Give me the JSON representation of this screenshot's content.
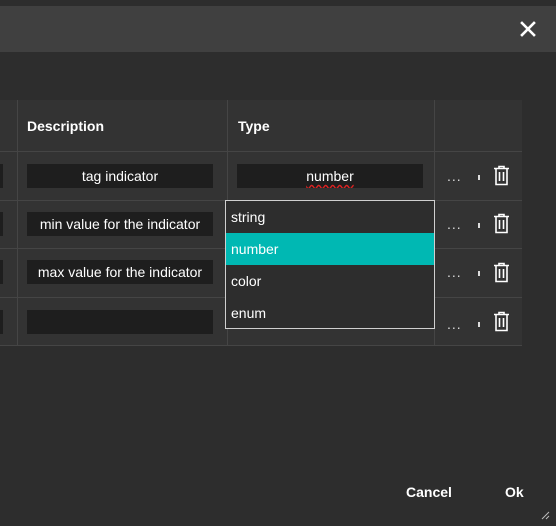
{
  "dialog": {
    "close_icon": "close-icon"
  },
  "table": {
    "headers": {
      "description": "Description",
      "type": "Type"
    },
    "rows": [
      {
        "description": "tag indicator",
        "type": "number"
      },
      {
        "description": "min value for the indicator",
        "type": ""
      },
      {
        "description": "max value for the indicator",
        "type": ""
      },
      {
        "description": "",
        "type": ""
      }
    ],
    "more_label": "...",
    "delete_icon": "trash-icon"
  },
  "dropdown": {
    "options": [
      "string",
      "number",
      "color",
      "enum"
    ],
    "selected": "number"
  },
  "footer": {
    "cancel_label": "Cancel",
    "ok_label": "Ok"
  },
  "colors": {
    "accent": "#00b8b3",
    "background": "#2d2d2d",
    "header": "#404040"
  }
}
